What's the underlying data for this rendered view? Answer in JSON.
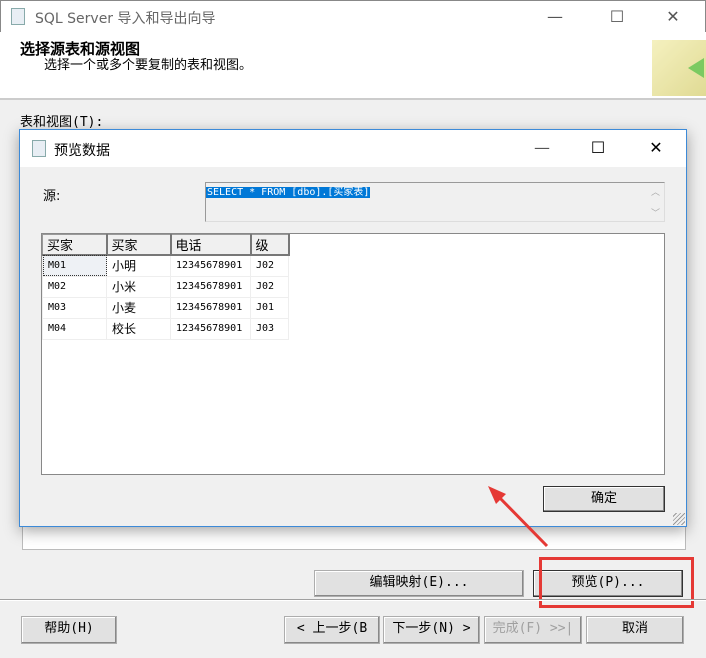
{
  "window": {
    "title": "SQL Server 导入和导出向导",
    "min": "—",
    "max": "☐",
    "close": "✕"
  },
  "header": {
    "title": "选择源表和源视图",
    "subtitle": "选择一个或多个要复制的表和视图。"
  },
  "tables_label": "表和视图(T):",
  "dialog": {
    "title": "预览数据",
    "min": "—",
    "max": "☐",
    "close": "✕",
    "source_label": "源:",
    "sql": "SELECT * FROM [dbo].[买家表]",
    "ok": "确定",
    "columns": [
      "买家",
      "买家",
      "电话",
      "级"
    ],
    "rows": [
      [
        "M01",
        "小明",
        "12345678901",
        "J02"
      ],
      [
        "M02",
        "小米",
        "12345678901",
        "J02"
      ],
      [
        "M03",
        "小麦",
        "12345678901",
        "J01"
      ],
      [
        "M04",
        "校长",
        "12345678901",
        "J03"
      ]
    ]
  },
  "buttons": {
    "edit_mapping": "编辑映射(E)...",
    "preview": "预览(P)...",
    "help": "帮助(H)",
    "back": "< 上一步(B",
    "next": "下一步(N) >",
    "finish": "完成(F) >>|",
    "cancel": "取消"
  },
  "colors": {
    "highlight": "#e53935",
    "accent": "#0078d7"
  }
}
